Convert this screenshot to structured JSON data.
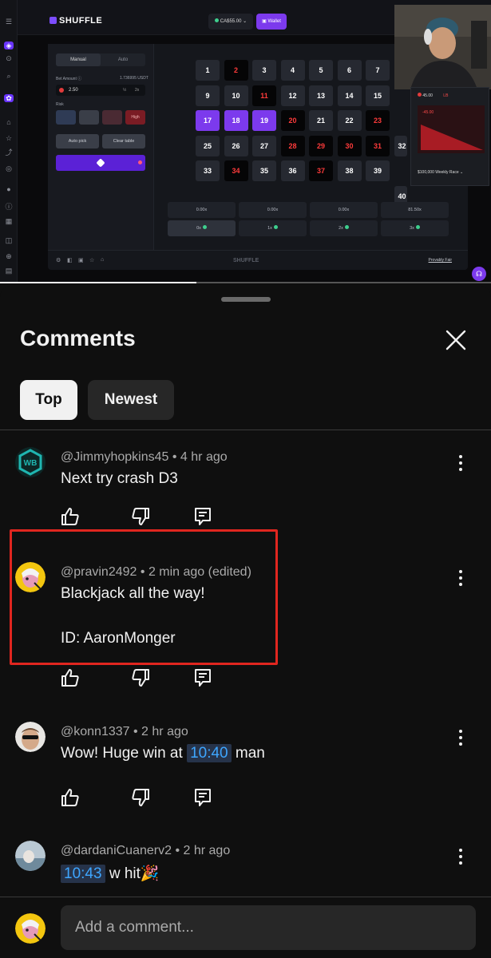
{
  "video": {
    "site": {
      "logo_text": "SHUFFLE",
      "balance": "CA$55.00",
      "wallet_label": "Wallet"
    },
    "game": {
      "tabs": [
        "Manual",
        "Auto"
      ],
      "bet_amount_label": "Bet Amount",
      "bet_amount_usdt": "1.736995 USDT",
      "bet_value": "2.50",
      "half_label": "½",
      "double_label": "2x",
      "risk_label": "Risk",
      "risk_selected": "High",
      "auto_pick_label": "Auto pick",
      "clear_table_label": "Clear table",
      "numbers": [
        {
          "n": "1",
          "style": "grey"
        },
        {
          "n": "2",
          "style": "black-red"
        },
        {
          "n": "3",
          "style": "grey"
        },
        {
          "n": "4",
          "style": "grey"
        },
        {
          "n": "5",
          "style": "grey"
        },
        {
          "n": "6",
          "style": "grey"
        },
        {
          "n": "7",
          "style": "grey"
        },
        {
          "n": "9",
          "style": "grey"
        },
        {
          "n": "10",
          "style": "grey"
        },
        {
          "n": "11",
          "style": "black-red"
        },
        {
          "n": "12",
          "style": "grey"
        },
        {
          "n": "13",
          "style": "grey"
        },
        {
          "n": "14",
          "style": "grey"
        },
        {
          "n": "15",
          "style": "grey"
        },
        {
          "n": "17",
          "style": "selected"
        },
        {
          "n": "18",
          "style": "selected"
        },
        {
          "n": "19",
          "style": "selected"
        },
        {
          "n": "20",
          "style": "black-red"
        },
        {
          "n": "21",
          "style": "grey"
        },
        {
          "n": "22",
          "style": "grey"
        },
        {
          "n": "23",
          "style": "black-red"
        },
        {
          "n": "25",
          "style": "grey"
        },
        {
          "n": "26",
          "style": "grey"
        },
        {
          "n": "27",
          "style": "grey"
        },
        {
          "n": "28",
          "style": "black-red"
        },
        {
          "n": "29",
          "style": "black-red"
        },
        {
          "n": "30",
          "style": "black-red"
        },
        {
          "n": "31",
          "style": "black-red"
        },
        {
          "n": "33",
          "style": "grey"
        },
        {
          "n": "34",
          "style": "black-red"
        },
        {
          "n": "35",
          "style": "grey"
        },
        {
          "n": "36",
          "style": "grey"
        },
        {
          "n": "37",
          "style": "black-red"
        },
        {
          "n": "38",
          "style": "grey"
        },
        {
          "n": "39",
          "style": "grey"
        }
      ],
      "edge_numbers": [
        "32",
        "40"
      ],
      "payouts": [
        "0.00x",
        "0.00x",
        "0.00x",
        "81.50x"
      ],
      "hits": [
        "0x",
        "1x",
        "2x",
        "3x"
      ],
      "footer_brand": "SHUFFLE",
      "provably_fair": "Provably Fair"
    },
    "overlay": {
      "amount": "45.00",
      "amount_tag": "LB",
      "profit": "-45.00",
      "race_label": "$100,000 Weekly Race"
    },
    "progress": 0.4
  },
  "comments_panel": {
    "title": "Comments",
    "filters": [
      "Top",
      "Newest"
    ],
    "active_filter": "Top",
    "comments": [
      {
        "author": "@Jimmyhopkins45",
        "time": "4 hr ago",
        "lines": [
          "Next try crash D3"
        ],
        "avatar_color": "#1fb5b0"
      },
      {
        "author": "@pravin2492",
        "time": "2 min ago (edited)",
        "lines": [
          "Blackjack all the way!",
          "ID: AaronMonger"
        ],
        "avatar_color": "#f3c60f"
      },
      {
        "author": "@konn1337",
        "time": "2 hr ago",
        "before": "Wow! Huge win at ",
        "timestamp": "10:40",
        "after": " man",
        "avatar_color": "#d8d4cf"
      },
      {
        "author": "@dardaniCuanerv2",
        "time": "2 hr ago",
        "timestamp": "10:43",
        "after": " w hit🎉",
        "avatar_color": "#9fb4c4"
      }
    ],
    "add_comment_placeholder": "Add a comment...",
    "separator": "•"
  },
  "colors": {
    "background": "#0f0f0f",
    "highlight_box": "#e0261f",
    "timestamp_link": "#3ea6ff",
    "accent": "#7c3aed"
  }
}
